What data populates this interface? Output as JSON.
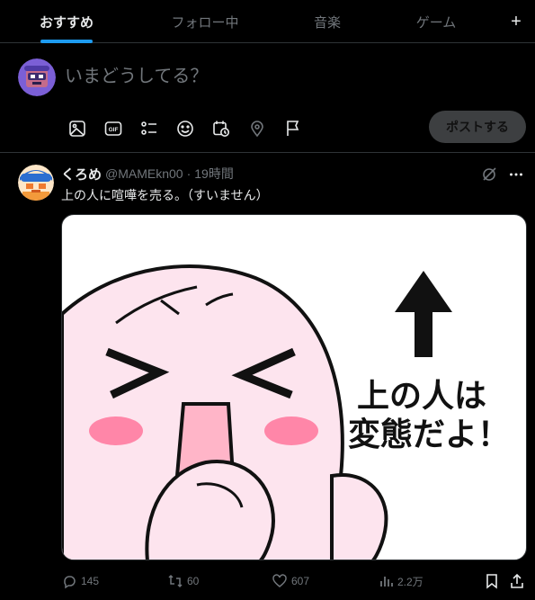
{
  "tabs": [
    {
      "label": "おすすめ",
      "active": true
    },
    {
      "label": "フォロー中",
      "active": false
    },
    {
      "label": "音楽",
      "active": false
    },
    {
      "label": "ゲーム",
      "active": false
    }
  ],
  "tab_add_symbol": "+",
  "composer": {
    "placeholder": "いまどうしてる？",
    "post_label": "ポストする",
    "tools": [
      "image-icon",
      "gif-icon",
      "poll-icon",
      "emoji-icon",
      "schedule-icon",
      "location-icon",
      "flag-icon"
    ],
    "gif_text": "GIF"
  },
  "tweet": {
    "display_name": "くろめ",
    "handle": "@MAMEkn00",
    "separator": "·",
    "time": "19時間",
    "text": "上の人に喧嘩を売る。（すいません）",
    "image": {
      "caption_line1": "上の人は",
      "caption_line2": "変態だよ！",
      "arrow_icon": "up-arrow-icon"
    },
    "stats": {
      "replies": "145",
      "reposts": "60",
      "likes": "607",
      "views": "2.2万"
    }
  },
  "colors": {
    "accent": "#1d9bf0",
    "muted": "#71767b",
    "text": "#e7e9ea",
    "border": "#2f3336",
    "character_pink": "#fde4ee",
    "cheek_pink": "#ff86a8"
  }
}
